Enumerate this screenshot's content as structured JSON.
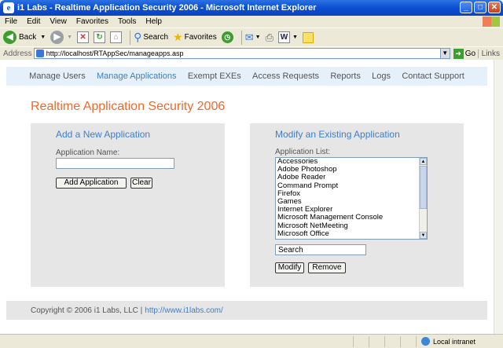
{
  "window": {
    "title": "i1 Labs - Realtime Application Security 2006 - Microsoft Internet Explorer"
  },
  "menu": [
    "File",
    "Edit",
    "View",
    "Favorites",
    "Tools",
    "Help"
  ],
  "toolbar": {
    "back_label": "Back",
    "search_label": "Search",
    "favorites_label": "Favorites"
  },
  "address": {
    "label": "Address",
    "url": "http://localhost/RTAppSec/manageapps.asp",
    "go_label": "Go",
    "links_label": "Links"
  },
  "nav": {
    "items": [
      "Manage Users",
      "Manage Applications",
      "Exempt EXEs",
      "Access Requests",
      "Reports",
      "Logs",
      "Contact Support"
    ],
    "active_index": 1
  },
  "page": {
    "title": "Realtime Application Security 2006"
  },
  "add_panel": {
    "title": "Add a New Application",
    "name_label": "Application Name:",
    "name_value": "",
    "add_button": "Add Application",
    "clear_button": "Clear"
  },
  "modify_panel": {
    "title": "Modify an Existing Application",
    "list_label": "Application List:",
    "apps": [
      "Accessories",
      "Adobe Photoshop",
      "Adobe Reader",
      "Command Prompt",
      "Firefox",
      "Games",
      "Internet Explorer",
      "Microsoft Management Console",
      "Microsoft NetMeeting",
      "Microsoft Office"
    ],
    "search_value": "Search",
    "modify_button": "Modify",
    "remove_button": "Remove"
  },
  "footer": {
    "copyright": "Copyright © 2006 i1 Labs, LLC |",
    "link": "http://www.i1labs.com/"
  },
  "status": {
    "zone": "Local intranet"
  }
}
